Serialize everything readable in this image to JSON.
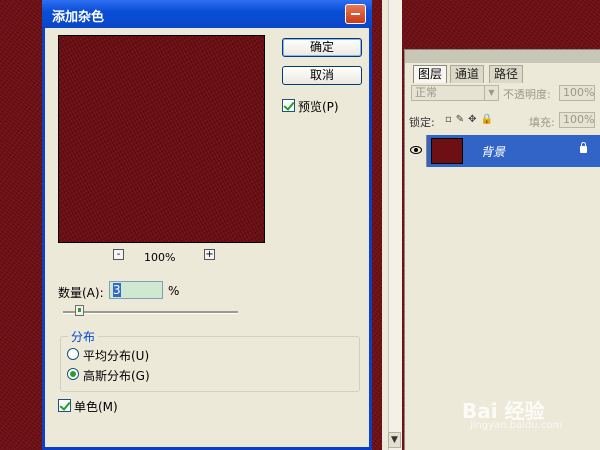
{
  "dialog": {
    "title": "添加杂色",
    "ok_label": "确定",
    "cancel_label": "取消",
    "preview_label": "预览(P)",
    "preview_checked": true,
    "zoom_minus": "-",
    "zoom_level": "100%",
    "zoom_plus": "+",
    "amount_label": "数量(A):",
    "amount_value": "3",
    "amount_unit": "%",
    "amount_slider_percent": 3,
    "distribution_label": "分布",
    "uniform_label": "平均分布(U)",
    "gaussian_label": "高斯分布(G)",
    "selected_distribution": "gaussian",
    "mono_label": "单色(M)",
    "mono_checked": true
  },
  "layers_panel": {
    "tabs": [
      "图层",
      "通道",
      "路径"
    ],
    "active_tab": "图层",
    "blend_mode": "正常",
    "opacity_label": "不透明度:",
    "opacity_value": "100%",
    "lock_label": "锁定:",
    "fill_label": "填充:",
    "fill_value": "100%",
    "layer_name": "背景",
    "layer_color": "#6e0f14"
  },
  "watermark": {
    "text": "Bai 经验",
    "sub": "jingyan.baidu.com"
  },
  "colors": {
    "canvas": "#6e0f14",
    "dialog_title": "#0a4fd8",
    "selected_layer": "#3264c8"
  }
}
